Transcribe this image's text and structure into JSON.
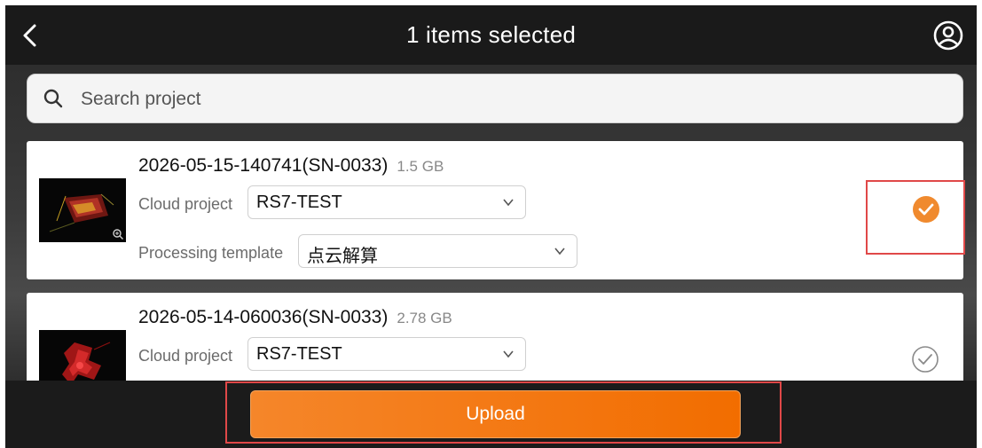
{
  "header": {
    "title": "1 items selected",
    "back_icon": "chevron-left-icon",
    "user_icon": "user-circle-icon"
  },
  "search": {
    "placeholder": "Search project",
    "value": ""
  },
  "projects": [
    {
      "name": "2026-05-15-140741(SN-0033)",
      "size": "1.5 GB",
      "cloud_project_label": "Cloud project",
      "cloud_project_value": "RS7-TEST",
      "template_label": "Processing template",
      "template_value": "点云解算",
      "selected": true
    },
    {
      "name": "2026-05-14-060036(SN-0033)",
      "size": "2.78 GB",
      "cloud_project_label": "Cloud project",
      "cloud_project_value": "RS7-TEST",
      "selected": false
    }
  ],
  "footer": {
    "upload_label": "Upload"
  },
  "colors": {
    "accent": "#F5862A",
    "highlight": "#E04848",
    "header_bg": "#1A1A1A"
  }
}
